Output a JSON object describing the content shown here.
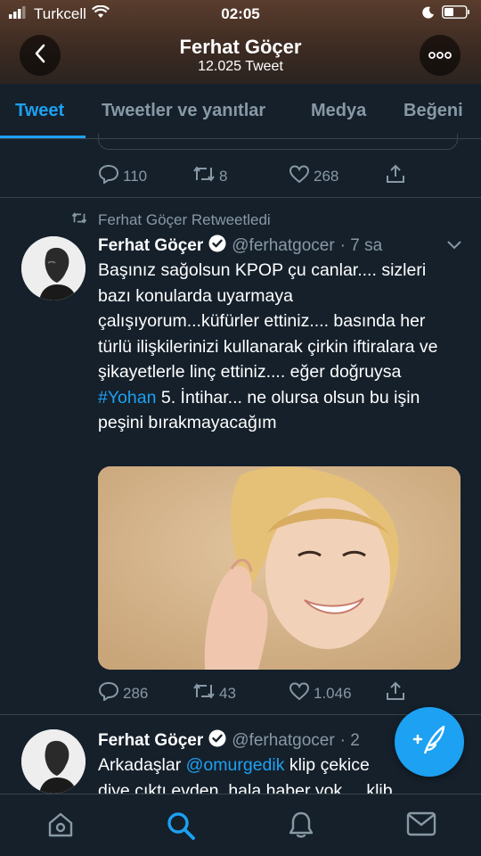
{
  "status": {
    "carrier": "Turkcell",
    "time": "02:05"
  },
  "header": {
    "title": "Ferhat Göçer",
    "subtitle": "12.025 Tweet"
  },
  "tabs": [
    {
      "label": "Tweet"
    },
    {
      "label": "Tweetler ve yanıtlar"
    },
    {
      "label": "Medya"
    },
    {
      "label": "Beğeni"
    }
  ],
  "top_tweet": {
    "replies": "110",
    "retweets": "8",
    "likes": "268"
  },
  "tweet1": {
    "retweet_note": "Ferhat Göçer Retweetledi",
    "name": "Ferhat Göçer",
    "handle": "@ferhatgocer",
    "time": "· 7 sa",
    "text_a": "Başınız sağolsun KPOP çu canlar.... sizleri bazı konularda uyarmaya çalışıyorum...küfürler ettiniz.... basında her türlü ilişkilerinizi kullanarak çirkin iftiralara ve şikayetlerle linç ettiniz.... eğer doğruysa ",
    "hashtag": "#Yohan",
    "text_b": " 5. İntihar... ne olursa olsun bu işin peşini bırakmayacağım",
    "replies": "286",
    "retweets": "43",
    "likes": "1.046"
  },
  "tweet2": {
    "name": "Ferhat Göçer",
    "handle": "@ferhatgocer",
    "time": "· 2",
    "text_a": "Arkadaşlar ",
    "mention": "@omurgedik",
    "text_b": "  klip çekice",
    "text_c": "diye çıktı evden, hala haber yok.... klibi"
  },
  "colors": {
    "accent": "#1da1f2",
    "background": "#15202b",
    "muted": "#8899a6"
  },
  "icons": [
    "reply-icon",
    "retweet-icon",
    "like-icon",
    "share-icon",
    "compose-icon",
    "home-icon",
    "search-icon",
    "notifications-icon",
    "messages-icon"
  ]
}
